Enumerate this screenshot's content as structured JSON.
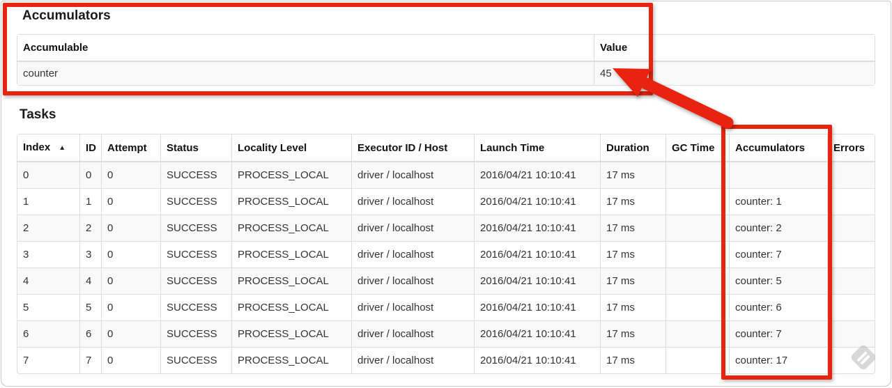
{
  "headings": {
    "accumulators": "Accumulators",
    "tasks": "Tasks"
  },
  "accumulators_table": {
    "columns": [
      "Accumulable",
      "Value"
    ],
    "rows": [
      [
        "counter",
        "45"
      ]
    ]
  },
  "tasks_table": {
    "columns": [
      "Index",
      "ID",
      "Attempt",
      "Status",
      "Locality Level",
      "Executor ID / Host",
      "Launch Time",
      "Duration",
      "GC Time",
      "Accumulators",
      "Errors"
    ],
    "sort": {
      "column": "Index",
      "direction": "ascending",
      "indicator": "▲"
    },
    "rows": [
      [
        "0",
        "0",
        "0",
        "SUCCESS",
        "PROCESS_LOCAL",
        "driver / localhost",
        "2016/04/21 10:10:41",
        "17 ms",
        "",
        "",
        ""
      ],
      [
        "1",
        "1",
        "0",
        "SUCCESS",
        "PROCESS_LOCAL",
        "driver / localhost",
        "2016/04/21 10:10:41",
        "17 ms",
        "",
        "counter: 1",
        ""
      ],
      [
        "2",
        "2",
        "0",
        "SUCCESS",
        "PROCESS_LOCAL",
        "driver / localhost",
        "2016/04/21 10:10:41",
        "17 ms",
        "",
        "counter: 2",
        ""
      ],
      [
        "3",
        "3",
        "0",
        "SUCCESS",
        "PROCESS_LOCAL",
        "driver / localhost",
        "2016/04/21 10:10:41",
        "17 ms",
        "",
        "counter: 7",
        ""
      ],
      [
        "4",
        "4",
        "0",
        "SUCCESS",
        "PROCESS_LOCAL",
        "driver / localhost",
        "2016/04/21 10:10:41",
        "17 ms",
        "",
        "counter: 5",
        ""
      ],
      [
        "5",
        "5",
        "0",
        "SUCCESS",
        "PROCESS_LOCAL",
        "driver / localhost",
        "2016/04/21 10:10:41",
        "17 ms",
        "",
        "counter: 6",
        ""
      ],
      [
        "6",
        "6",
        "0",
        "SUCCESS",
        "PROCESS_LOCAL",
        "driver / localhost",
        "2016/04/21 10:10:41",
        "17 ms",
        "",
        "counter: 7",
        ""
      ],
      [
        "7",
        "7",
        "0",
        "SUCCESS",
        "PROCESS_LOCAL",
        "driver / localhost",
        "2016/04/21 10:10:41",
        "17 ms",
        "",
        "counter: 17",
        ""
      ]
    ]
  },
  "annotations": {
    "color": "#e8230f",
    "watermark_color": "#b9b9b9",
    "highlighted_value": "45",
    "highlighted_column": "Accumulators"
  }
}
